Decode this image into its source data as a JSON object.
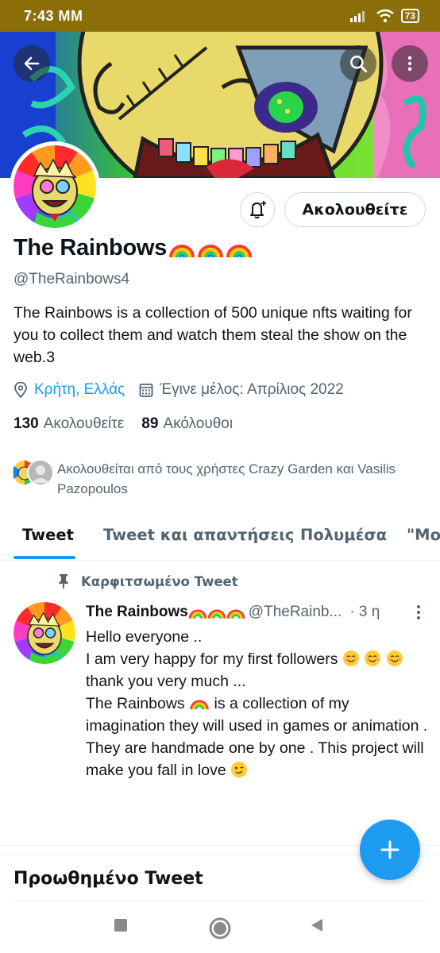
{
  "status_bar": {
    "time": "7:43 MM",
    "battery": "73"
  },
  "profile": {
    "name": "The Rainbows",
    "handle": "@TheRainbows4",
    "bio": "The Rainbows is a collection of 500 unique nfts waiting for you to collect them and watch them steal the show on the web.3",
    "location": "Κρήτη, Ελλάς",
    "joined": "Έγινε μέλος: Απρίλιος 2022",
    "following_count": "130",
    "following_label": "Ακολουθείτε",
    "followers_count": "89",
    "followers_label": "Ακόλουθοι",
    "followed_by_text": "Ακολουθείται από τους χρήστες Crazy Garden και Vasilis Pazopoulos",
    "follow_button_label": "Ακολουθείτε"
  },
  "tabs": [
    {
      "label": "Tweet"
    },
    {
      "label": "Tweet και απαντήσεις"
    },
    {
      "label": "Πολυμέσα"
    },
    {
      "label": "\"Μου"
    }
  ],
  "pinned_tweet": {
    "pinned_label": "Καρφιτσωμένο Tweet",
    "author_name": "The Rainbows",
    "author_handle": "@TheRainb...",
    "time": "· 3 η",
    "lines": [
      "Hello everyone ..",
      "I am very happy for my first followers",
      "thank you very much ...",
      "The Rainbows",
      "is a collection of my imagination they will used in games or animation .",
      "They are handmade one by one . This project will make you fall in love"
    ]
  },
  "promoted": {
    "title": "Προωθημένο Tweet"
  },
  "colors": {
    "accent": "#1d9bf0",
    "text_secondary": "#536471",
    "status_bar": "#8a6f08"
  },
  "icons": [
    "back-arrow-icon",
    "search-icon",
    "more-vert-icon",
    "bell-plus-icon",
    "location-pin-icon",
    "calendar-icon",
    "pin-icon",
    "plus-icon"
  ]
}
